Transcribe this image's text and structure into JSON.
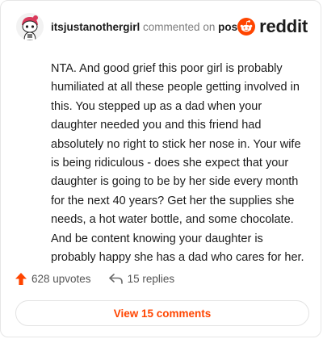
{
  "comment": {
    "username": "itsjustanothergirl",
    "commented_on": "commented on",
    "post_label": "post",
    "body": "NTA. And good grief this poor girl is probably humiliated at all these people getting involved in this. You stepped up as a dad when your daughter needed you and this friend had absolutely no right to stick her nose in. Your wife is being ridiculous - does she expect that your daughter is going to be by her side every month for the next 40 years? Get her the supplies she needs, a hot water bottle, and some chocolate. And be content knowing your daughter is probably happy she has a dad who cares for her."
  },
  "brand": {
    "name": "reddit",
    "accent": "#ff4500"
  },
  "stats": {
    "upvotes": "628 upvotes",
    "replies": "15 replies",
    "upvote_icon": "upvote-arrow-icon",
    "reply_icon": "reply-arrow-icon"
  },
  "actions": {
    "view_comments": "View 15 comments"
  },
  "colors": {
    "accent": "#ff4500",
    "text": "#1c1c1c",
    "muted": "#7c7c7c",
    "border": "#e3e3e3"
  }
}
